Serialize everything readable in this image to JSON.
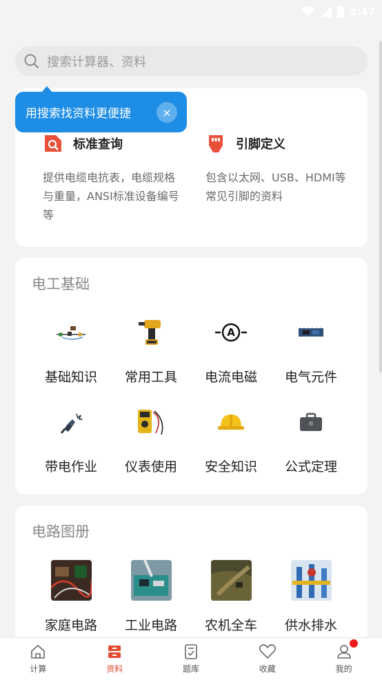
{
  "status_bar": {
    "time": "2:47"
  },
  "search": {
    "placeholder": "搜索计算器、资料"
  },
  "tooltip": {
    "text": "用搜索找资料更便捷",
    "close_glyph": "×"
  },
  "features": [
    {
      "title": "标准查询",
      "description": "提供电缆电抗表，电缆规格与重量，ANSI标准设备编号等",
      "icon": "search-doc-icon",
      "color": "#e8503a"
    },
    {
      "title": "引脚定义",
      "description": "包含以太网、USB、HDMI等常见引脚的资料",
      "icon": "connector-icon",
      "color": "#e8503a"
    }
  ],
  "sections": {
    "electrical_basics": {
      "title": "电工基础",
      "items": [
        {
          "label": "基础知识",
          "icon": "circuit-kit-icon"
        },
        {
          "label": "常用工具",
          "icon": "drill-icon"
        },
        {
          "label": "电流电磁",
          "icon": "ammeter-symbol-icon"
        },
        {
          "label": "电气元件",
          "icon": "circuit-board-icon"
        },
        {
          "label": "带电作业",
          "icon": "plug-spark-icon"
        },
        {
          "label": "仪表使用",
          "icon": "multimeter-icon"
        },
        {
          "label": "安全知识",
          "icon": "hard-hat-icon"
        },
        {
          "label": "公式定理",
          "icon": "toolbox-icon"
        }
      ]
    },
    "circuit_atlas": {
      "title": "电路图册",
      "items": [
        {
          "label": "家庭电路",
          "icon": "home-circuit-photo"
        },
        {
          "label": "工业电路",
          "icon": "industrial-circuit-photo"
        },
        {
          "label": "农机全车",
          "icon": "farm-machinery-photo"
        },
        {
          "label": "供水排水",
          "icon": "water-supply-photo"
        }
      ]
    }
  },
  "tabbar": {
    "items": [
      {
        "label": "计算",
        "icon": "house-icon",
        "active": false
      },
      {
        "label": "资料",
        "icon": "books-icon",
        "active": true
      },
      {
        "label": "题库",
        "icon": "checklist-icon",
        "active": false
      },
      {
        "label": "收藏",
        "icon": "heart-icon",
        "active": false
      },
      {
        "label": "我的",
        "icon": "user-icon",
        "active": false,
        "badge": true
      }
    ],
    "active_color": "#e34b30"
  }
}
